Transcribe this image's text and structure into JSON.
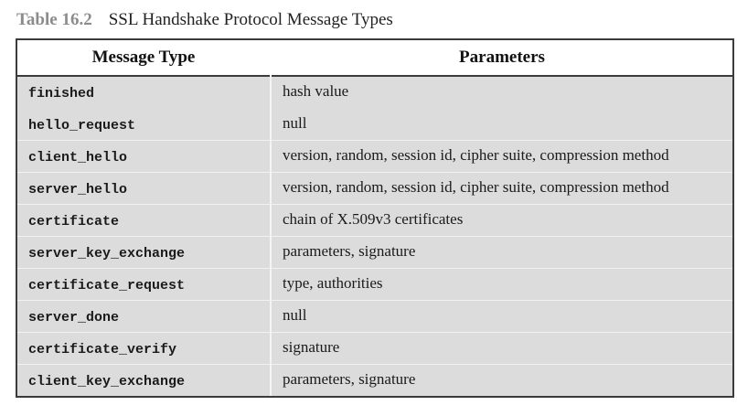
{
  "caption": {
    "number": "Table 16.2",
    "title": "SSL Handshake Protocol Message Types"
  },
  "table": {
    "headers": [
      "Message Type",
      "Parameters"
    ],
    "rows": [
      {
        "type": "hello_request",
        "params": "null"
      },
      {
        "type": "client_hello",
        "params": "version, random, session id, cipher suite, compression method"
      },
      {
        "type": "server_hello",
        "params": "version, random, session id, cipher suite, compression method"
      },
      {
        "type": "certificate",
        "params": "chain of X.509v3 certificates"
      },
      {
        "type": "server_key_exchange",
        "params": "parameters, signature"
      },
      {
        "type": "certificate_request",
        "params": "type, authorities"
      },
      {
        "type": "server_done",
        "params": "null"
      },
      {
        "type": "certificate_verify",
        "params": "signature"
      },
      {
        "type": "client_key_exchange",
        "params": "parameters, signature"
      },
      {
        "type": "finished",
        "params": "hash value"
      }
    ]
  },
  "colors": {
    "body_background": "#dcdcdc",
    "header_background": "#ffffff",
    "border": "#3b3b3b",
    "caption_number": "#8c8c8c"
  }
}
